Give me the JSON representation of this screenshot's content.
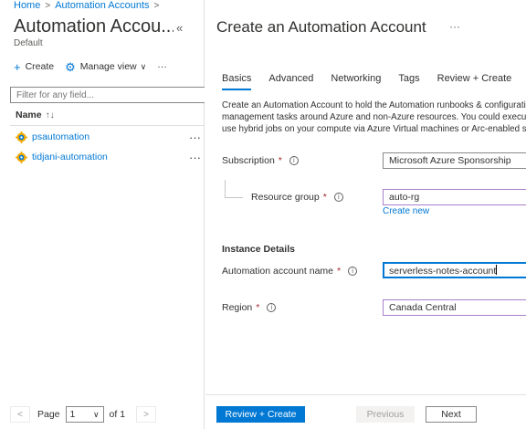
{
  "breadcrumb": {
    "home": "Home",
    "current": "Automation Accounts"
  },
  "left_blade": {
    "title": "Automation Accou...",
    "subtitle": "Default",
    "collapse_glyph": "«",
    "commands": {
      "create": "Create",
      "manage_view": "Manage view",
      "more": "···"
    },
    "filter_placeholder": "Filter for any field...",
    "column_name": "Name",
    "sort_glyph": "↑↓",
    "rows": [
      {
        "name": "psautomation",
        "more": "···"
      },
      {
        "name": "tidjani-automation",
        "more": "···"
      }
    ],
    "pager": {
      "prev": "<",
      "page_label": "Page",
      "page_value": "1",
      "of_label": "of 1",
      "next": ">"
    }
  },
  "blade": {
    "title": "Create an Automation Account",
    "ellipsis": "···",
    "tabs": [
      "Basics",
      "Advanced",
      "Networking",
      "Tags",
      "Review + Create"
    ],
    "description": [
      "Create an Automation Account to hold the Automation runbooks & configuration",
      "management tasks around Azure and non-Azure resources. You could execute clou",
      "use hybrid jobs on your compute via Azure Virtual machines or Arc-enabled server"
    ],
    "fields": {
      "subscription": {
        "label": "Subscription",
        "value": "Microsoft Azure Sponsorship"
      },
      "resource_group": {
        "label": "Resource group",
        "value": "auto-rg",
        "create_new": "Create new"
      },
      "instance_details": "Instance Details",
      "account_name": {
        "label": "Automation account name",
        "value": "serverless-notes-account"
      },
      "region": {
        "label": "Region",
        "value": "Canada Central"
      }
    },
    "required_mark": "*",
    "footer": {
      "review_create": "Review + Create",
      "previous": "Previous",
      "next": "Next"
    }
  },
  "colors": {
    "accent": "#0078d4",
    "required": "#a4262c",
    "validation_border": "#a980c9"
  },
  "icons": [
    "plus-icon",
    "gear-icon",
    "chevron-down-icon",
    "info-icon",
    "automation-account-icon",
    "sort-icon"
  ]
}
